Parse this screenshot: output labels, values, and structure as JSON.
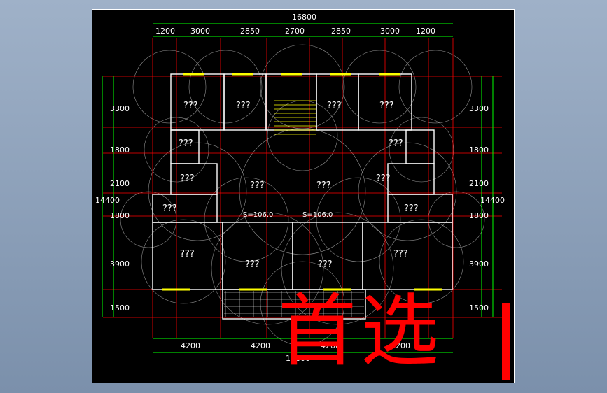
{
  "drawing": {
    "top_overall": "16800",
    "top_segments": [
      "1200",
      "3000",
      "2850",
      "2700",
      "2850",
      "3000",
      "1200"
    ],
    "left_segments": [
      "3300",
      "1800",
      "2100",
      "1800",
      "3900",
      "1500"
    ],
    "right_segments": [
      "3300",
      "1800",
      "2100",
      "1800",
      "3900",
      "1500"
    ],
    "left_overall": "14400",
    "right_overall": "14400",
    "bottom_segments": [
      "4200",
      "4200",
      "4200",
      "4200"
    ],
    "bottom_overall": "16800",
    "room_labels": [
      "???",
      "???",
      "???",
      "???",
      "???",
      "???",
      "???",
      "???",
      "???",
      "???",
      "???",
      "???",
      "???",
      "???",
      "???",
      "???"
    ],
    "unit_areas": [
      "S=106.0",
      "S=106.0"
    ]
  },
  "overlay": {
    "stamp_text": "首选"
  },
  "colors": {
    "background": "#000000",
    "walls": "#ffffff",
    "dimension_lines": "#00ff00",
    "axis_lines": "#ff0000",
    "windows": "#ffff00",
    "arcs": "#c0c0c0",
    "stamp": "#ff0000"
  }
}
